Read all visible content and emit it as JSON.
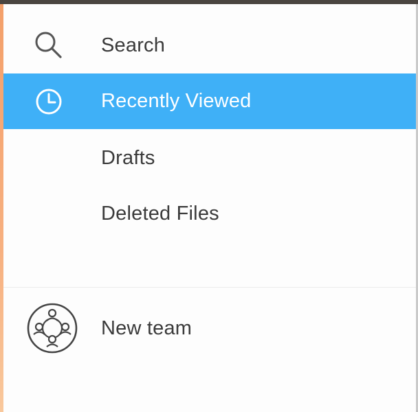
{
  "theme": {
    "accent": "#3fb0f7"
  },
  "sidebar": {
    "items": [
      {
        "label": "Search",
        "icon": "search-icon",
        "active": false
      },
      {
        "label": "Recently Viewed",
        "icon": "clock-icon",
        "active": true
      },
      {
        "label": "Drafts",
        "icon": null,
        "active": false
      },
      {
        "label": "Deleted Files",
        "icon": null,
        "active": false
      }
    ],
    "team": {
      "label": "New team",
      "icon": "team-icon"
    }
  }
}
